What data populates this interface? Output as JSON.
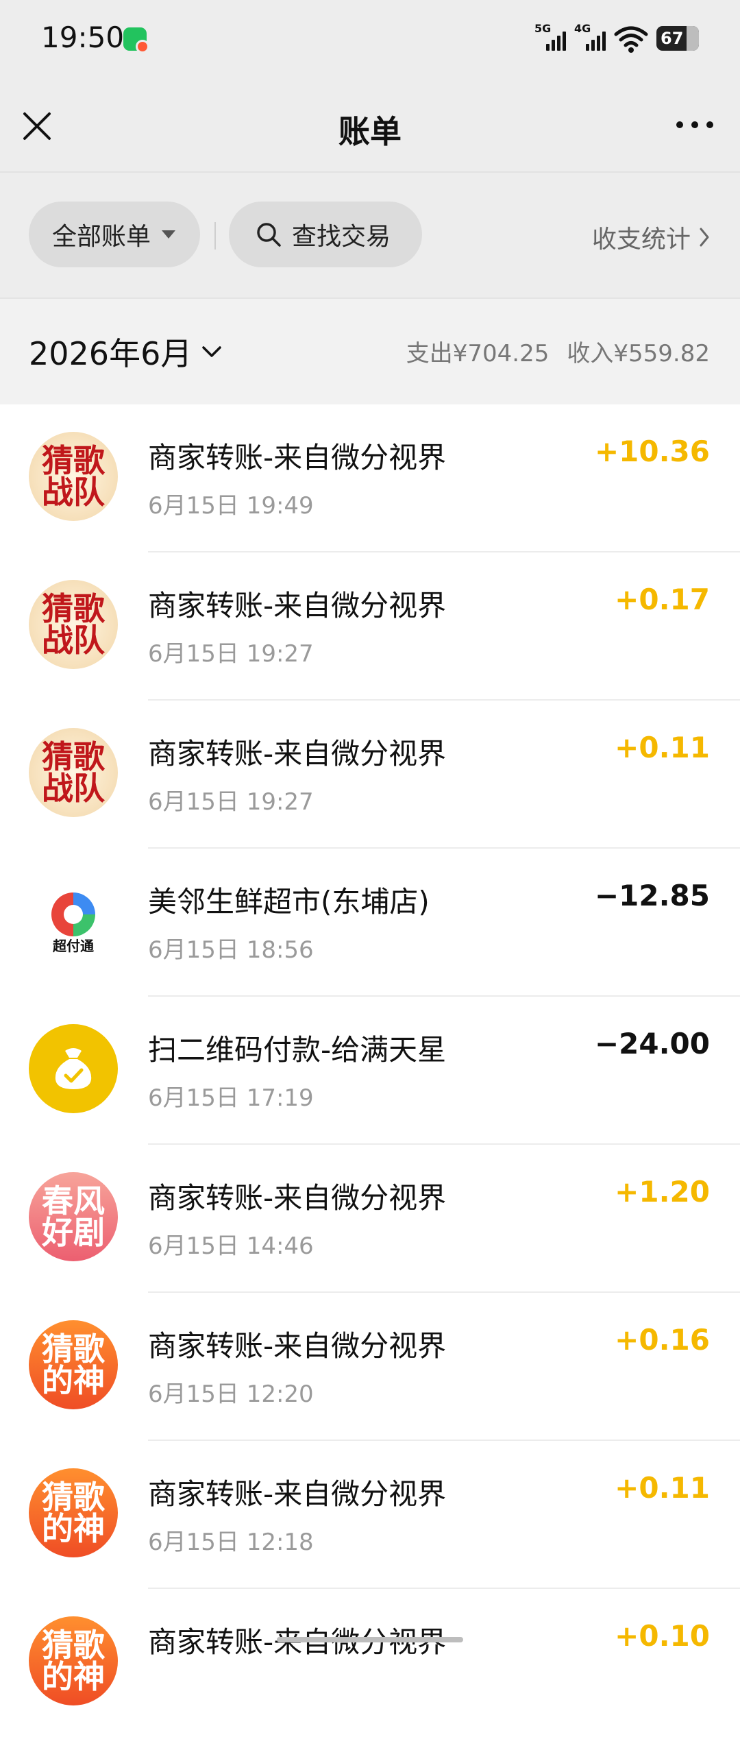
{
  "status_bar": {
    "time": "19:50",
    "network_1": "5G",
    "network_2": "4G",
    "battery": "67",
    "notification_icon": "wechat-icon"
  },
  "nav": {
    "title": "账单",
    "close_icon": "close-icon",
    "more_icon": "more-icon"
  },
  "filters": {
    "all_bills": "全部账单",
    "search": "查找交易",
    "stats": "收支统计"
  },
  "month": {
    "label": "2026年6月",
    "expense": "支出¥704.25",
    "income": "收入¥559.82"
  },
  "colors": {
    "income": "#f5b800",
    "expense": "#111111"
  },
  "transactions": [
    {
      "icon_text_1": "猜歌",
      "icon_text_2": "战队",
      "name": "商家转账-来自微分视界",
      "time": "6月15日 19:49",
      "amount": "+10.36",
      "type": "income"
    },
    {
      "icon_text_1": "猜歌",
      "icon_text_2": "战队",
      "name": "商家转账-来自微分视界",
      "time": "6月15日 19:27",
      "amount": "+0.17",
      "type": "income"
    },
    {
      "icon_text_1": "猜歌",
      "icon_text_2": "战队",
      "name": "商家转账-来自微分视界",
      "time": "6月15日 19:27",
      "amount": "+0.11",
      "type": "income"
    },
    {
      "icon_label": "超付通",
      "name": "美邻生鲜超市(东埔店)",
      "time": "6月15日 18:56",
      "amount": "−12.85",
      "type": "expense"
    },
    {
      "icon": "money-bag-icon",
      "name": "扫二维码付款-给满天星",
      "time": "6月15日 17:19",
      "amount": "−24.00",
      "type": "expense"
    },
    {
      "icon_text_1": "春风",
      "icon_text_2": "好剧",
      "name": "商家转账-来自微分视界",
      "time": "6月15日 14:46",
      "amount": "+1.20",
      "type": "income"
    },
    {
      "icon_text_1": "猜歌",
      "icon_text_2": "的神",
      "name": "商家转账-来自微分视界",
      "time": "6月15日 12:20",
      "amount": "+0.16",
      "type": "income"
    },
    {
      "icon_text_1": "猜歌",
      "icon_text_2": "的神",
      "name": "商家转账-来自微分视界",
      "time": "6月15日 12:18",
      "amount": "+0.11",
      "type": "income"
    },
    {
      "icon_text_1": "猜歌",
      "icon_text_2": "的神",
      "name": "商家转账-来自微分视界",
      "time": "",
      "amount": "+0.10",
      "type": "income"
    }
  ]
}
